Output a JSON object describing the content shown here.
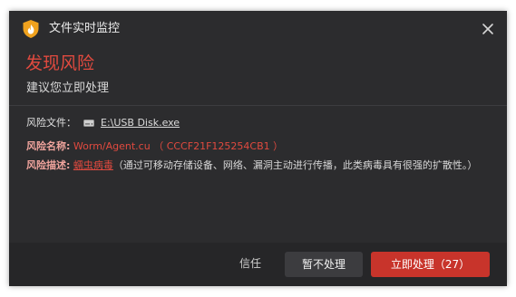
{
  "window": {
    "title": "文件实时监控",
    "close_icon": "close-icon",
    "logo_icon": "shield-flame-icon"
  },
  "alert": {
    "title": "发现风险",
    "subtitle": "建议您立即处理"
  },
  "details": {
    "file_label": "风险文件：",
    "file_icon": "drive-icon",
    "file_path": "E:\\USB Disk.exe",
    "name_label": "风险名称:",
    "virus_name": "Worm/Agent.cu",
    "virus_hash": "（ CCCF21F125254CB1 ）",
    "desc_label": "风险描述:",
    "desc_link": "蠕虫病毒",
    "desc_text": "（通过可移动存储设备、网络、漏洞主动进行传播，此类病毒具有很强的扩散性。）"
  },
  "footer": {
    "trust_label": "信任",
    "ignore_label": "暂不处理",
    "handle_label": "立即处理（27）"
  },
  "colors": {
    "accent_red": "#e14a3f",
    "button_red": "#c8342b",
    "background": "#2c2c2e"
  }
}
